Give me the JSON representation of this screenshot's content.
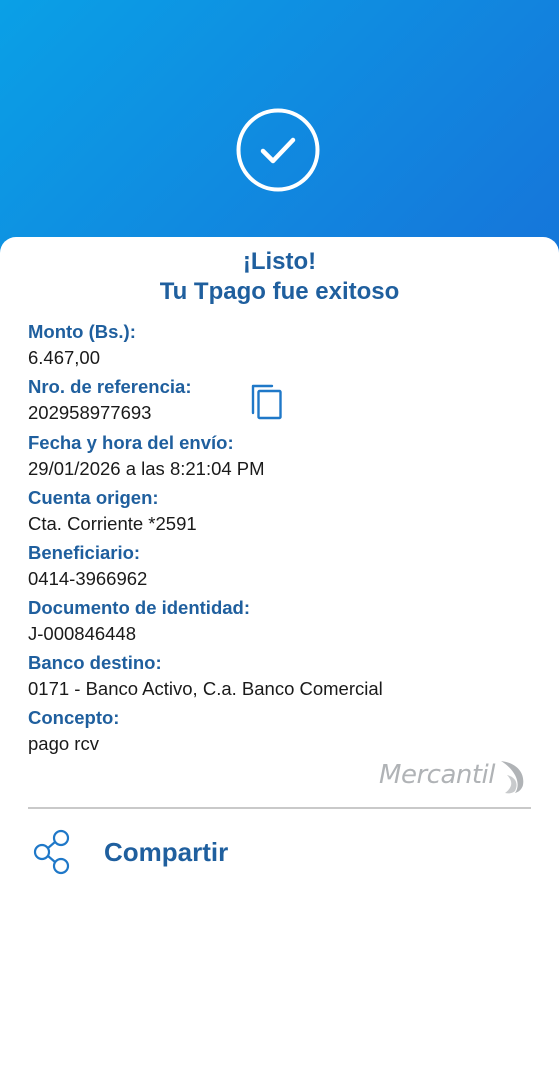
{
  "header": {
    "icon": "check-circle-icon"
  },
  "title": {
    "line1": "¡Listo!",
    "line2": "Tu Tpago fue exitoso"
  },
  "fields": [
    {
      "label": "Monto (Bs.):",
      "value": "6.467,00"
    },
    {
      "label": "Nro. de referencia:",
      "value": "202958977693"
    },
    {
      "label": "Fecha y hora del envío:",
      "value": "29/01/2026 a las 8:21:04 PM"
    },
    {
      "label": "Cuenta origen:",
      "value": "Cta. Corriente *2591"
    },
    {
      "label": "Beneficiario:",
      "value": "0414-3966962"
    },
    {
      "label": "Documento de identidad:",
      "value": "J-000846448"
    },
    {
      "label": "Banco destino:",
      "value": "0171 - Banco Activo, C.a. Banco Comercial"
    },
    {
      "label": "Concepto:",
      "value": "pago rcv"
    }
  ],
  "copy": {
    "icon": "copy-icon"
  },
  "brand": {
    "name": "Mercantil"
  },
  "share": {
    "label": "Compartir",
    "icon": "share-icon"
  },
  "colors": {
    "accent": "#1f5f9e",
    "header_gradient_start": "#0aa0e6",
    "header_gradient_end": "#0b64d3",
    "text": "#1a1a1a",
    "brand_gray": "#b0b3b6"
  }
}
